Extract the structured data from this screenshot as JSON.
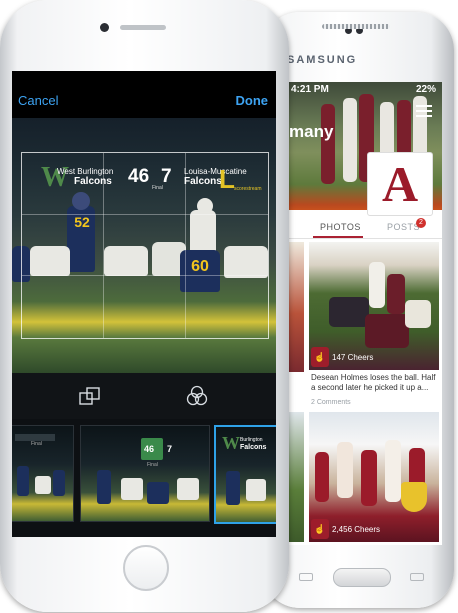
{
  "editor": {
    "cancel_label": "Cancel",
    "done_label": "Done",
    "scoreboard": {
      "home_abbr": "W",
      "home_city": "West Burlington",
      "home_team": "Falcons",
      "home_score": "46",
      "away_score": "7",
      "status": "Final",
      "away_city": "Louisa-Muscatine",
      "away_team": "Falcons",
      "away_abbr": "L",
      "brand": "scorestream"
    },
    "jerseys": [
      "52",
      "60"
    ],
    "tools": [
      "crop-icon",
      "filters-icon"
    ],
    "filter_thumbnails": 3,
    "selected_thumbnail_index": 2,
    "thumb1_label": "Final",
    "thumb2_scores": [
      "46",
      "7"
    ],
    "thumb2_label": "Final",
    "thumb3_abbr": "W",
    "thumb3_city": "Burlington",
    "thumb3_team": "Falcons",
    "accent_color": "#3da3f2"
  },
  "team_app": {
    "brand": "SAMSUNG",
    "status_time": "4:21 PM",
    "status_battery": "22%",
    "page_title": "many",
    "logo_letter": "A",
    "tabs": [
      {
        "label": "PHOTOS",
        "active": true
      },
      {
        "label": "POSTS",
        "active": false,
        "badge": "2"
      }
    ],
    "posts": [
      {
        "cheers": "147 Cheers",
        "caption": "Desean Holmes loses the ball. Half a second later he picked it up a...",
        "comments": "2 Comments"
      },
      {
        "cheers": "2,456 Cheers"
      }
    ],
    "brand_color": "#9b1b2a"
  }
}
